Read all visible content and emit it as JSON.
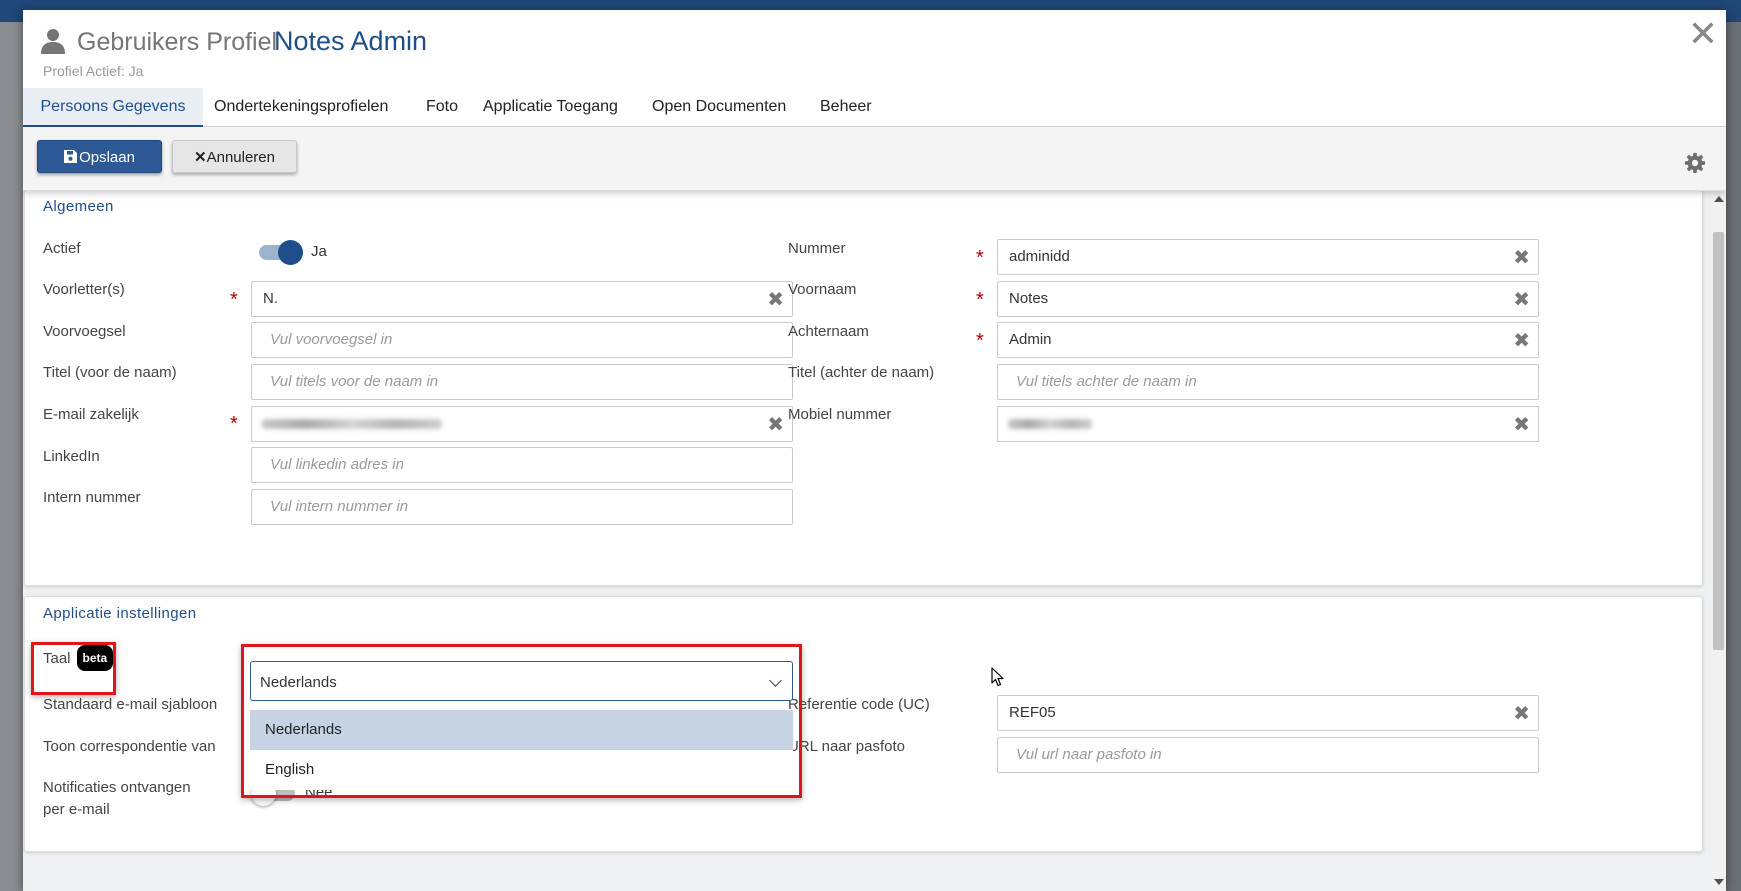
{
  "dialog": {
    "title_label": "Gebruikers Profiel",
    "title_name": "Notes Admin",
    "subtitle": "Profiel Actief: Ja",
    "close_glyph": "✕"
  },
  "tabs": [
    {
      "label": "Persoons Gegevens",
      "active": true
    },
    {
      "label": "Ondertekeningsprofielen",
      "active": false
    },
    {
      "label": "Foto",
      "active": false
    },
    {
      "label": "Applicatie Toegang",
      "active": false
    },
    {
      "label": "Open Documenten",
      "active": false
    },
    {
      "label": "Beheer",
      "active": false
    }
  ],
  "toolbar": {
    "save_label": "Opslaan",
    "cancel_label": "Annuleren"
  },
  "algemeen": {
    "title": "Algemeen",
    "actief_label": "Actief",
    "actief_value": "Ja",
    "voorletters_label": "Voorletter(s)",
    "voorletters_value": "N.",
    "voorvoegsel_label": "Voorvoegsel",
    "voorvoegsel_placeholder": "Vul voorvoegsel in",
    "titel_voor_label": "Titel (voor de naam)",
    "titel_voor_placeholder": "Vul titels voor de naam in",
    "email_label": "E-mail zakelijk",
    "linkedin_label": "LinkedIn",
    "linkedin_placeholder": "Vul linkedin adres in",
    "intern_label": "Intern nummer",
    "intern_placeholder": "Vul intern nummer in",
    "nummer_label": "Nummer",
    "nummer_value": "adminidd",
    "voornaam_label": "Voornaam",
    "voornaam_value": "Notes",
    "achternaam_label": "Achternaam",
    "achternaam_value": "Admin",
    "titel_achter_label": "Titel (achter de naam)",
    "titel_achter_placeholder": "Vul titels achter de naam in",
    "mobiel_label": "Mobiel nummer"
  },
  "app": {
    "title": "Applicatie instellingen",
    "taal_label": "Taal",
    "beta_badge": "beta",
    "taal_selected": "Nederlands",
    "taal_options": [
      "Nederlands",
      "English"
    ],
    "email_sjabloon_label": "Standaard e-mail sjabloon",
    "correspondentie_label": "Toon correspondentie van",
    "notificaties_label": "Notificaties ontvangen per e-mail",
    "notificaties_value": "Nee",
    "referentie_label": "Referentie code (UC)",
    "referentie_value": "REF05",
    "pasfoto_label": "URL naar pasfoto",
    "pasfoto_placeholder": "Vul url naar pasfoto in"
  },
  "colors": {
    "accent": "#1f4f8a",
    "primary_button": "#2d5a96",
    "required": "#b00000",
    "highlight": "#e0141a"
  }
}
